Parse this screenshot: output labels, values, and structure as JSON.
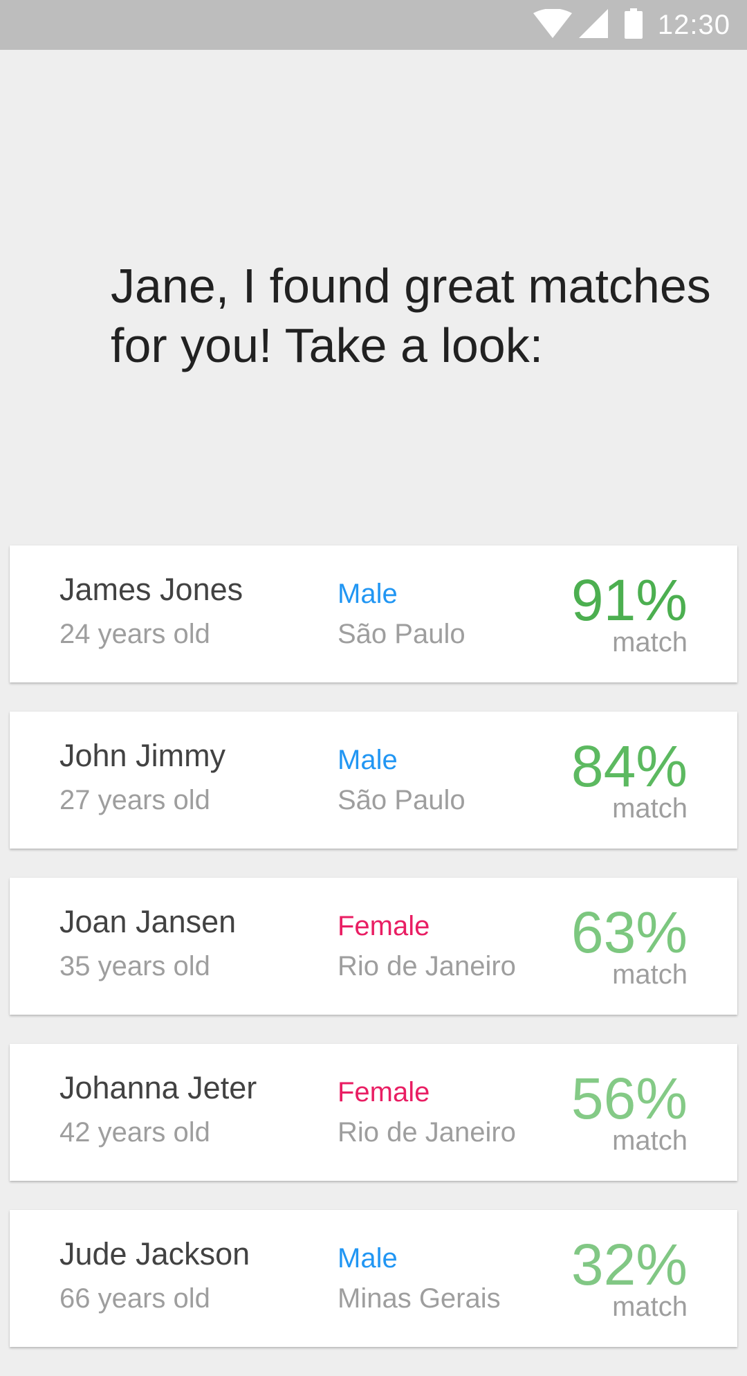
{
  "status_bar": {
    "time": "12:30",
    "icons": [
      "wifi-icon",
      "signal-icon",
      "battery-icon"
    ]
  },
  "headline": "Jane, I found great matches for you! Take a look:",
  "colors": {
    "male": "#2196F3",
    "female": "#E91E63"
  },
  "matches": [
    {
      "name": "James Jones",
      "age": "24 years old",
      "gender": "Male",
      "location": "São Paulo",
      "percent": "91%",
      "match_label": "match",
      "color": "#4CAF50"
    },
    {
      "name": "John Jimmy",
      "age": "27 years old",
      "gender": "Male",
      "location": "São Paulo",
      "percent": "84%",
      "match_label": "match",
      "color": "#5CB960"
    },
    {
      "name": "Joan Jansen",
      "age": "35 years old",
      "gender": "Female",
      "location": "Rio de Janeiro",
      "percent": "63%",
      "match_label": "match",
      "color": "#7CC77F"
    },
    {
      "name": "Johanna Jeter",
      "age": "42 years old",
      "gender": "Female",
      "location": "Rio de Janeiro",
      "percent": "56%",
      "match_label": "match",
      "color": "#84CA86"
    },
    {
      "name": "Jude Jackson",
      "age": "66 years old",
      "gender": "Male",
      "location": "Minas Gerais",
      "percent": "32%",
      "match_label": "match",
      "color": "#81C784"
    }
  ]
}
